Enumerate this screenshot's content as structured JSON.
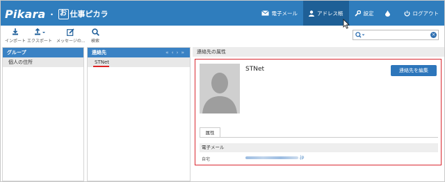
{
  "app": {
    "logo": "Pikara",
    "logo_sep": "・",
    "logo_box": "お",
    "logo_sub": "仕事ピカラ"
  },
  "nav": {
    "mail": "電子メール",
    "address": "アドレス帳",
    "settings": "設定",
    "logout": "ログアウト"
  },
  "toolbar": {
    "import": "インポート",
    "export": "エクスポート",
    "message": "メッセージの...",
    "search": "検索"
  },
  "panels": {
    "groups_title": "グループ",
    "group_item": "個人の住所",
    "contacts_title": "連絡先",
    "contact_item": "STNet",
    "detail_title": "連絡先の属性"
  },
  "detail": {
    "name": "STNet",
    "edit_label": "連絡先を編集",
    "tab_label": "属性",
    "section_label": "電子メール",
    "prop_label": "自宅",
    "email_tld": ".jp"
  },
  "colors": {
    "header": "#2f7dbd",
    "header_active": "#1e5f96",
    "accent_red": "#d9262f",
    "button": "#2d76bb"
  }
}
